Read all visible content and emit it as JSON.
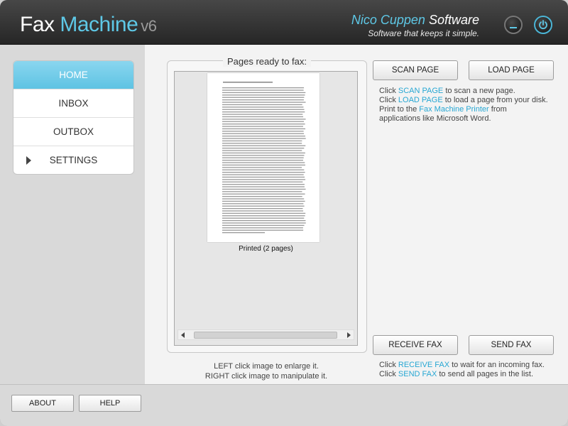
{
  "app": {
    "title_part1": "Fax",
    "title_part2": "Machine",
    "version": "v6",
    "brand_part1": "Nico Cuppen",
    "brand_part2": "Software",
    "tagline": "Software that keeps it simple."
  },
  "window_controls": {
    "minimize_icon": "minimize-icon",
    "power_icon": "power-icon"
  },
  "sidebar": {
    "items": [
      {
        "label": "HOME",
        "active": true
      },
      {
        "label": "INBOX",
        "active": false
      },
      {
        "label": "OUTBOX",
        "active": false
      },
      {
        "label": "SETTINGS",
        "active": false,
        "expandable": true
      }
    ]
  },
  "pages": {
    "title": "Pages ready to fax:",
    "document_caption": "Printed (2 pages)",
    "hint_line1": "LEFT click image to enlarge it.",
    "hint_line2": "RIGHT click image to manipulate it."
  },
  "actions": {
    "scan_label": "SCAN PAGE",
    "load_label": "LOAD PAGE",
    "receive_label": "RECEIVE FAX",
    "send_label": "SEND FAX"
  },
  "info_top": {
    "l1_pre": "Click ",
    "l1_hl": "SCAN PAGE",
    "l1_post": " to scan a new page.",
    "l2_pre": "Click ",
    "l2_hl": "LOAD PAGE",
    "l2_post": " to load a page from your disk.",
    "l3_pre": "Print to the ",
    "l3_hl": "Fax Machine Printer",
    "l3_post": " from",
    "l4": "applications like Microsoft Word."
  },
  "info_bottom": {
    "l1_pre": "Click ",
    "l1_hl": "RECEIVE FAX",
    "l1_post": " to wait for an incoming fax.",
    "l2_pre": "Click ",
    "l2_hl": "SEND FAX",
    "l2_post": " to send all pages in the list."
  },
  "footer": {
    "about_label": "ABOUT",
    "help_label": "HELP"
  },
  "colors": {
    "accent": "#5ec8e6",
    "link": "#27a7d3",
    "header_bg": "#2e2e2e"
  }
}
